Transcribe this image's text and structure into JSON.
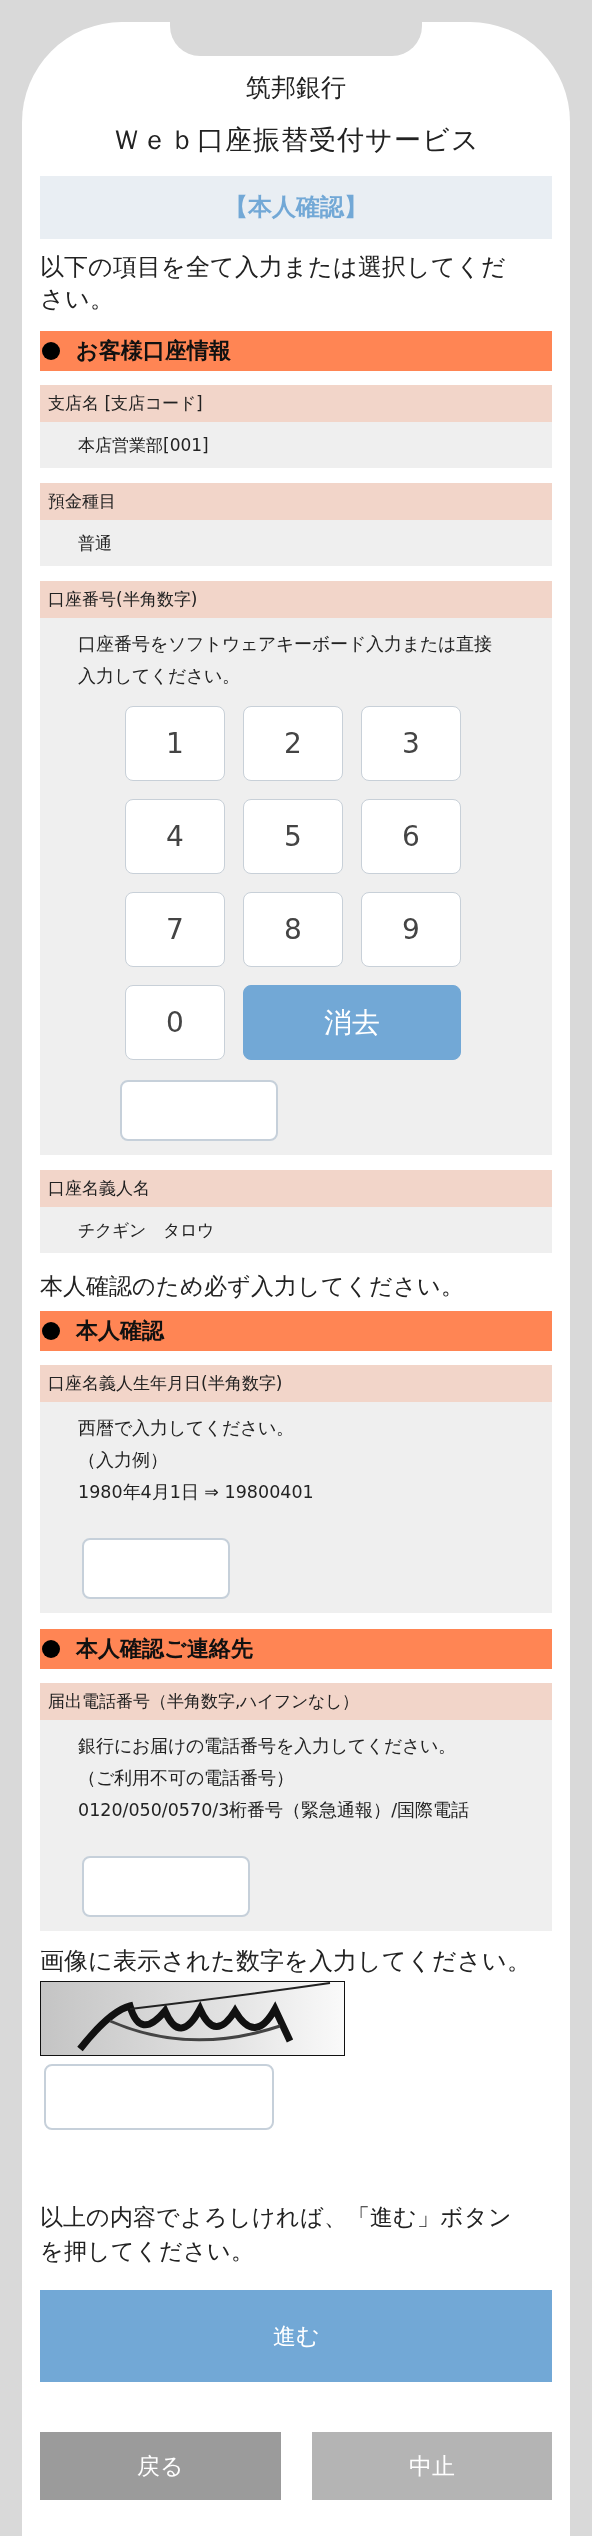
{
  "header": {
    "bank": "筑邦銀行",
    "service": "Ｗｅｂ口座振替受付サービス"
  },
  "page_title": "【本人確認】",
  "intro": "以下の項目を全て入力または選択してください。",
  "blocks": [
    {
      "kind": "section",
      "title": "お客様口座情報"
    },
    {
      "kind": "field",
      "label": "支店名 [支店コード]",
      "value": "本店営業部[001]"
    },
    {
      "kind": "field",
      "label": "預金種目",
      "value": "普通"
    },
    {
      "kind": "field",
      "label": "口座番号(半角数字)",
      "lines": [
        "口座番号をソフトウェアキーボード入力または直接入力してください。"
      ],
      "keypad": [
        {
          "label": "1",
          "kind": "digit"
        },
        {
          "label": "2",
          "kind": "digit"
        },
        {
          "label": "3",
          "kind": "digit"
        },
        {
          "label": "4",
          "kind": "digit"
        },
        {
          "label": "5",
          "kind": "digit"
        },
        {
          "label": "6",
          "kind": "digit"
        },
        {
          "label": "7",
          "kind": "digit"
        },
        {
          "label": "8",
          "kind": "digit"
        },
        {
          "label": "9",
          "kind": "digit"
        },
        {
          "label": "0",
          "kind": "digit"
        },
        {
          "label": "消去",
          "kind": "clear"
        }
      ]
    },
    {
      "kind": "field",
      "label": "口座名義人名",
      "value": "チクギン　タロウ"
    },
    {
      "kind": "note",
      "text": "本人確認のため必ず入力してください。"
    },
    {
      "kind": "section",
      "title": "本人確認"
    },
    {
      "kind": "field",
      "label": "口座名義人生年月日(半角数字)",
      "lines": [
        "西暦で入力してください。",
        "（入力例）",
        "1980年4月1日 ⇒ 19800401"
      ]
    },
    {
      "kind": "section",
      "title": "本人確認ご連絡先"
    },
    {
      "kind": "field",
      "label": "届出電話番号（半角数字,ハイフンなし）",
      "lines": [
        "銀行にお届けの電話番号を入力してください。",
        "（ご利用不可の電話番号）",
        "0120/050/0570/3桁番号（緊急通報）/国際電話"
      ]
    },
    {
      "kind": "captcha",
      "text": "画像に表示された数字を入力してください。"
    },
    {
      "kind": "confirm",
      "text": "以上の内容でよろしければ、「進む」ボタンを押してください。"
    }
  ],
  "primary_button": "進む",
  "buttons": [
    {
      "label": "戻る",
      "kind": "back"
    },
    {
      "label": "中止",
      "kind": "cancel"
    }
  ]
}
